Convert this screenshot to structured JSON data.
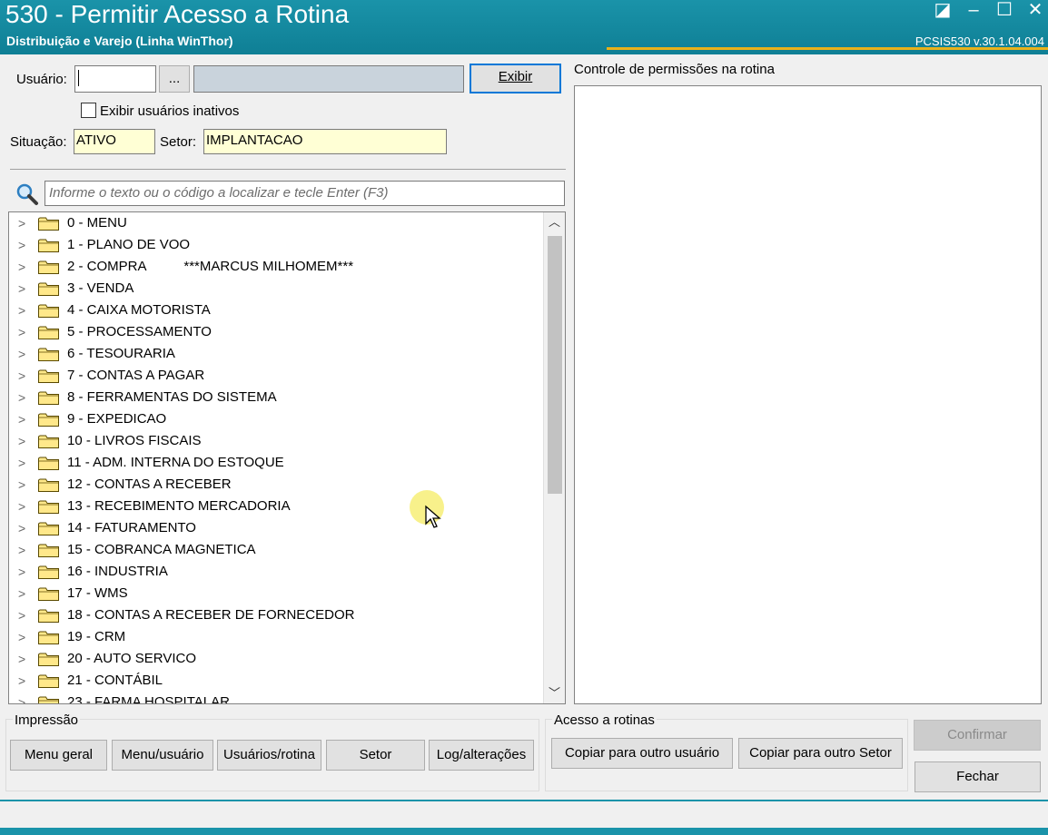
{
  "window": {
    "title": "530 - Permitir Acesso a Rotina",
    "subtitle": "Distribuição e Varejo (Linha WinThor)",
    "version": "PCSIS530  v.30.1.04.004",
    "controls": {
      "restore": "◪",
      "minimize": "–",
      "maximize": "☐",
      "close": "✕"
    }
  },
  "user": {
    "label": "Usuário:",
    "code_value": "",
    "lookup_label": "...",
    "name_value": "",
    "show_button": "Exibir",
    "inactive_label": "Exibir usuários inativos",
    "inactive_checked": false,
    "status_label": "Situação:",
    "status_value": "ATIVO",
    "sector_label": "Setor:",
    "sector_value": "IMPLANTACAO"
  },
  "search": {
    "placeholder": "Informe o texto ou o código a localizar e tecle Enter (F3)"
  },
  "tree": {
    "items": [
      "0 - MENU",
      "1 - PLANO DE VOO",
      "2 - COMPRA          ***MARCUS MILHOMEM***",
      "3 - VENDA",
      "4 - CAIXA MOTORISTA",
      "5 - PROCESSAMENTO",
      "6 - TESOURARIA",
      "7 - CONTAS A PAGAR",
      "8 - FERRAMENTAS DO SISTEMA",
      "9 - EXPEDICAO",
      "10 - LIVROS FISCAIS",
      "11 - ADM. INTERNA DO ESTOQUE",
      "12 - CONTAS A RECEBER",
      "13 - RECEBIMENTO MERCADORIA",
      "14 - FATURAMENTO",
      "15 - COBRANCA MAGNETICA",
      "16 - INDUSTRIA",
      "17 - WMS",
      "18 - CONTAS A RECEBER DE FORNECEDOR",
      "19 - CRM",
      "20 - AUTO SERVICO",
      "21 - CONTÁBIL",
      "23 - FARMA HOSPITALAR"
    ]
  },
  "permissions": {
    "label": "Controle de permissões na rotina"
  },
  "printing": {
    "title": "Impressão",
    "buttons": [
      "Menu geral",
      "Menu/usuário",
      "Usuários/rotina",
      "Setor",
      "Log/alterações"
    ]
  },
  "access": {
    "title": "Acesso a rotinas",
    "copy_user": "Copiar para outro usuário",
    "copy_sector": "Copiar para outro Setor"
  },
  "actions": {
    "confirm": "Confirmar",
    "close": "Fechar"
  }
}
